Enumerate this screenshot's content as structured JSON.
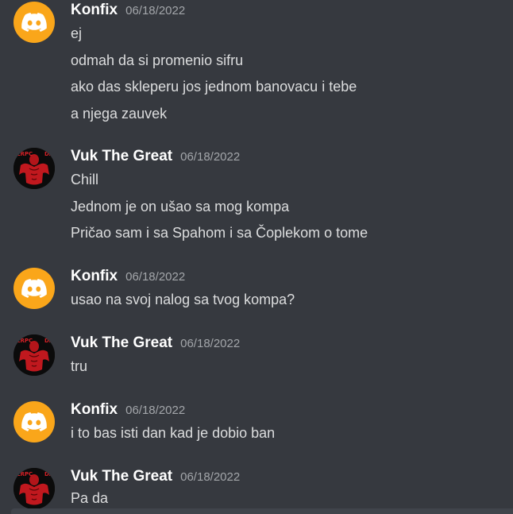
{
  "messages": [
    {
      "author": "Konfix",
      "timestamp": "06/18/2022",
      "avatar_icon": "discord-logo-icon",
      "lines": [
        "ej",
        "odmah da si promenio sifru",
        "ako das skleperu jos jednom banovacu i tebe",
        "a njega zauvek"
      ]
    },
    {
      "author": "Vuk The Great",
      "timestamp": "06/18/2022",
      "avatar_icon": "muscular-red-figure-icon",
      "lines": [
        "Chill",
        "Jednom je on ušao sa mog kompa",
        "Pričao sam i sa Spahom i sa Čoplekom o tome"
      ]
    },
    {
      "author": "Konfix",
      "timestamp": "06/18/2022",
      "avatar_icon": "discord-logo-icon",
      "lines": [
        "usao na svoj nalog sa tvog kompa?"
      ]
    },
    {
      "author": "Vuk The Great",
      "timestamp": "06/18/2022",
      "avatar_icon": "muscular-red-figure-icon",
      "lines": [
        "tru"
      ]
    },
    {
      "author": "Konfix",
      "timestamp": "06/18/2022",
      "avatar_icon": "discord-logo-icon",
      "lines": [
        "i to bas isti dan kad je dobio ban"
      ]
    },
    {
      "author": "Vuk The Great",
      "timestamp": "06/18/2022",
      "avatar_icon": "muscular-red-figure-icon",
      "lines": [
        "Pa da"
      ]
    }
  ],
  "colors": {
    "background": "#36393f",
    "author": "#ffffff",
    "timestamp": "#a3a6aa",
    "message_text": "#dcddde",
    "discord_avatar": "#faa61a"
  }
}
